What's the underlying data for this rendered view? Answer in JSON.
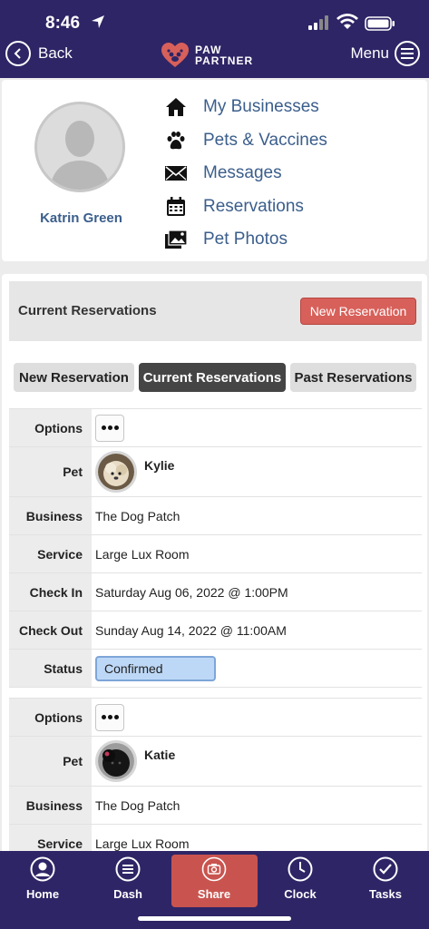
{
  "status_bar": {
    "time": "8:46"
  },
  "header": {
    "back_label": "Back",
    "menu_label": "Menu",
    "logo_line1": "PAW",
    "logo_line2": "PARTNER"
  },
  "profile": {
    "name": "Katrin Green",
    "nav": [
      {
        "label": "My Businesses",
        "icon": "house-icon"
      },
      {
        "label": "Pets & Vaccines",
        "icon": "paw-icon"
      },
      {
        "label": "Messages",
        "icon": "envelope-icon"
      },
      {
        "label": "Reservations",
        "icon": "calendar-icon"
      },
      {
        "label": "Pet Photos",
        "icon": "photos-icon"
      }
    ]
  },
  "reservations": {
    "title": "Current Reservations",
    "new_button": "New Reservation",
    "tabs": [
      {
        "label": "New Reservation",
        "active": false
      },
      {
        "label": "Current Reservations",
        "active": true
      },
      {
        "label": "Past Reservations",
        "active": false
      }
    ],
    "labels": {
      "options": "Options",
      "pet": "Pet",
      "business": "Business",
      "service": "Service",
      "check_in": "Check In",
      "check_out": "Check Out",
      "status": "Status"
    },
    "items": [
      {
        "pet": "Kylie",
        "business": "The Dog Patch",
        "service": "Large Lux Room",
        "check_in": "Saturday Aug 06, 2022 @ 1:00PM",
        "check_out": "Sunday Aug 14, 2022 @ 11:00AM",
        "status": "Confirmed"
      },
      {
        "pet": "Katie",
        "business": "The Dog Patch",
        "service": "Large Lux Room"
      }
    ]
  },
  "tabbar": {
    "home": "Home",
    "dash": "Dash",
    "share": "Share",
    "clock": "Clock",
    "tasks": "Tasks"
  },
  "colors": {
    "header_bg": "#2e2566",
    "accent_red": "#d8605a",
    "link_blue": "#3b5e8c",
    "status_blue": "#bdd8f6"
  }
}
